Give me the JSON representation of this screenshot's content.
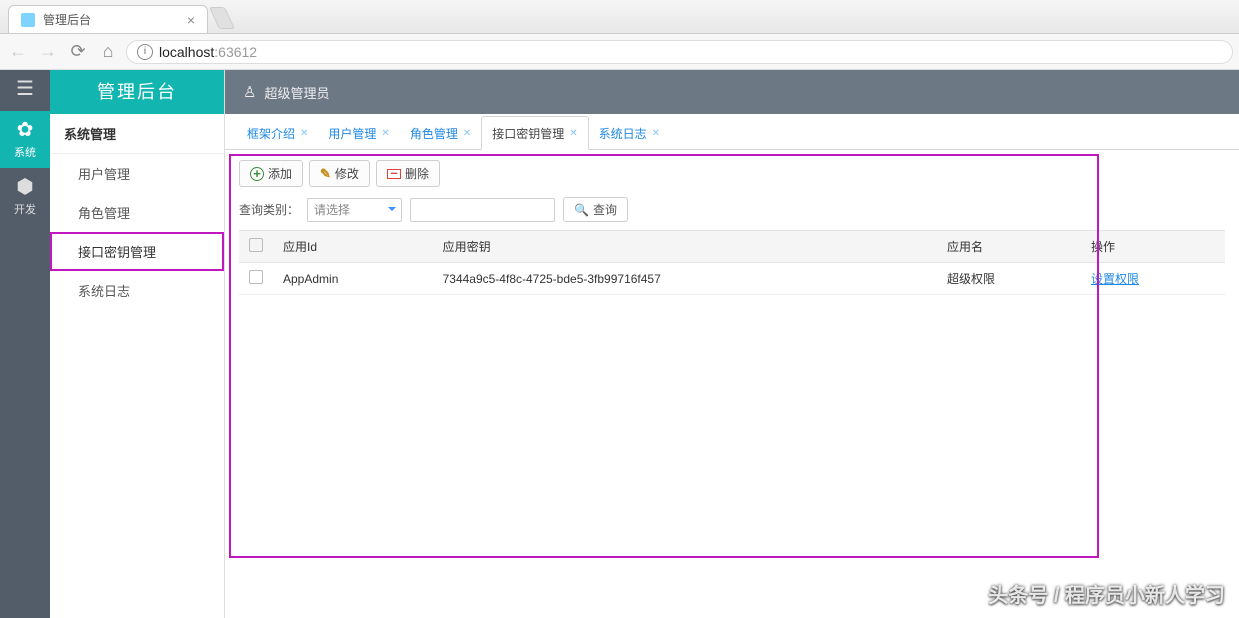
{
  "browser": {
    "tab_title": "管理后台",
    "url_host": "localhost",
    "url_port": ":63612"
  },
  "brand": "管理后台",
  "rail": [
    {
      "icon": "☰",
      "label": ""
    },
    {
      "icon": "✿",
      "label": "系统"
    },
    {
      "icon": "⬢",
      "label": "开发"
    }
  ],
  "sidebar": {
    "title": "系统管理",
    "items": [
      "用户管理",
      "角色管理",
      "接口密钥管理",
      "系统日志"
    ],
    "active_index": 2
  },
  "topbar": {
    "user": "超级管理员"
  },
  "tabs": {
    "items": [
      "框架介绍",
      "用户管理",
      "角色管理",
      "接口密钥管理",
      "系统日志"
    ],
    "active_index": 3
  },
  "toolbar": {
    "add": "添加",
    "edit": "修改",
    "del": "删除"
  },
  "filter": {
    "label": "查询类别：",
    "placeholder": "请选择",
    "query_btn": "查询"
  },
  "table": {
    "columns": [
      "应用Id",
      "应用密钥",
      "应用名",
      "操作"
    ],
    "rows": [
      {
        "appId": "AppAdmin",
        "secret": "7344a9c5-4f8c-4725-bde5-3fb99716f457",
        "appName": "超级权限",
        "action": "设置权限"
      }
    ]
  },
  "watermark": "头条号 / 程序员小新人学习"
}
